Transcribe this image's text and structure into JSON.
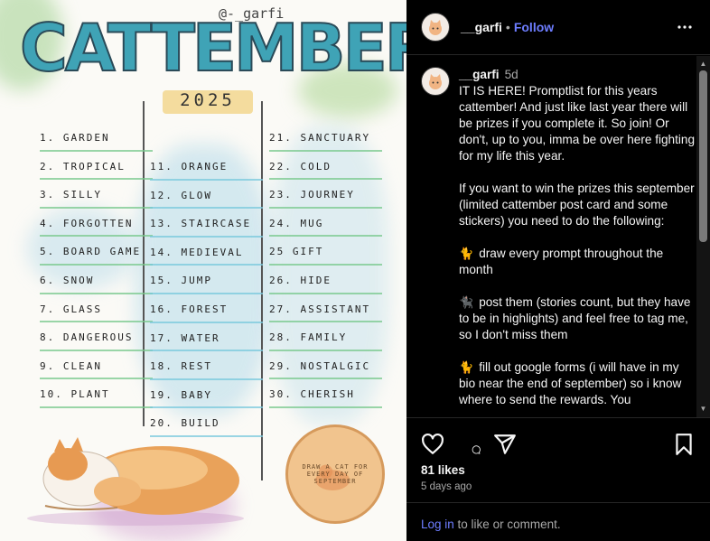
{
  "post_image": {
    "art_title": "CATTEMBER",
    "art_handle": "@-_garfi",
    "art_year": "2025",
    "prompts_col1": [
      "1. GARDEN",
      "2. TROPICAL",
      "3. SILLY",
      "4. FORGOTTEN",
      "5. BOARD GAME",
      "6. SNOW",
      "7. GLASS",
      "8. DANGEROUS",
      "9. CLEAN",
      "10. PLANT"
    ],
    "prompts_col2": [
      "11. ORANGE",
      "12. GLOW",
      "13. STAIRCASE",
      "14. MEDIEVAL",
      "15. JUMP",
      "16. FOREST",
      "17. WATER",
      "18. REST",
      "19. BABY",
      "20. BUILD"
    ],
    "prompts_col3": [
      "21. SANCTUARY",
      "22. COLD",
      "23. JOURNEY",
      "24. MUG",
      "25 GIFT",
      "26. HIDE",
      "27. ASSISTANT",
      "28. FAMILY",
      "29. NOSTALGIC",
      "30. CHERISH"
    ],
    "coin_text": "DRAW A CAT FOR EVERY DAY OF SEPTEMBER"
  },
  "header": {
    "username": "__garfi",
    "separator": "•",
    "follow_label": "Follow"
  },
  "caption": {
    "username": "__garfi",
    "time": "5d",
    "paragraphs": [
      "IT IS HERE! Promptlist for this years cattember! And just like last year there will be prizes if you complete it. So join! Or don't, up to you, imma be over here fighting for my life this year.",
      "If you want to win the prizes this september (limited cattember post card and some stickers) you need to do the following:"
    ],
    "steps": [
      {
        "emoji": "🐈",
        "emoji_color": "#e8a24a",
        "text": "draw every prompt throughout the month"
      },
      {
        "emoji": "🐈‍⬛",
        "emoji_color": "#7b5bd6",
        "text": "post them (stories count, but they have to be in highlights) and feel free to tag me, so I don't miss them"
      },
      {
        "emoji": "🐈",
        "emoji_color": "#e8a24a",
        "text": "fill out google forms (i will have in my bio near the end of september) so i know where to send the rewards. You"
      }
    ]
  },
  "actions": {
    "likes": "81 likes",
    "date": "5 days ago"
  },
  "footer": {
    "login_label": "Log in",
    "rest": " to like or comment."
  },
  "colors": {
    "background": "#000000",
    "text": "#f5f5f5",
    "muted": "#a8a8a8",
    "link": "#6d7dff",
    "divider": "#262626"
  }
}
